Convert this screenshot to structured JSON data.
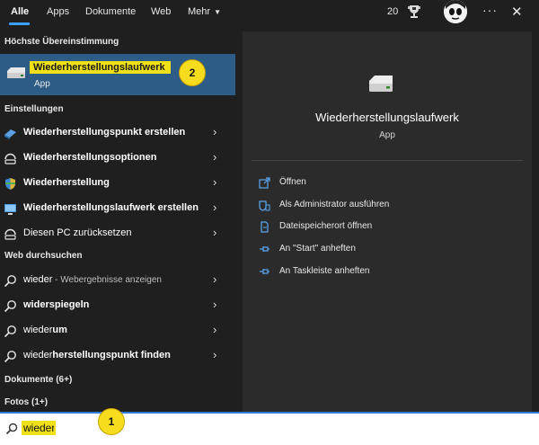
{
  "tabs": [
    {
      "label": "Alle",
      "active": true
    },
    {
      "label": "Apps"
    },
    {
      "label": "Dokumente"
    },
    {
      "label": "Web"
    },
    {
      "label": "Mehr"
    }
  ],
  "topbar": {
    "points": "20",
    "more": "···",
    "close": "✕"
  },
  "sections": {
    "best": "Höchste Übereinstimmung",
    "settings": "Einstellungen",
    "web": "Web durchsuchen",
    "docs": "Dokumente (6+)",
    "photos": "Fotos (1+)"
  },
  "best_match": {
    "title": "Wiederherstellungslaufwerk",
    "subtitle": "App",
    "badge": "2"
  },
  "settings_items": [
    {
      "bold": "Wieder",
      "rest": "herstellungspunkt erstellen",
      "icon": "system-restore-icon"
    },
    {
      "bold": "Wieder",
      "rest": "herstellungsoptionen",
      "icon": "recovery-options-icon"
    },
    {
      "bold": "Wieder",
      "rest": "herstellung",
      "icon": "shield-icon"
    },
    {
      "bold": "Wieder",
      "rest": "herstellungslaufwerk erstellen",
      "icon": "monitor-icon"
    },
    {
      "text": "Diesen PC zurücksetzen",
      "icon": "reset-pc-icon"
    }
  ],
  "web_items": [
    {
      "prefix": "wieder",
      "bold": "",
      "hint": " - Webergebnisse anzeigen"
    },
    {
      "prefix": "",
      "bold": "widerspiegeln",
      "hint": ""
    },
    {
      "prefix": "wieder",
      "bold": "um",
      "hint": ""
    },
    {
      "prefix": "wieder",
      "bold": "herstellungspunkt finden",
      "hint": ""
    }
  ],
  "detail": {
    "title": "Wiederherstellungslaufwerk",
    "subtitle": "App"
  },
  "actions": [
    {
      "label": "Öffnen",
      "icon": "open-icon"
    },
    {
      "label": "Als Administrator ausführen",
      "icon": "admin-shield-icon"
    },
    {
      "label": "Dateispeicherort öffnen",
      "icon": "file-location-icon"
    },
    {
      "label": "An \"Start\" anheften",
      "icon": "pin-icon"
    },
    {
      "label": "An Taskleiste anheften",
      "icon": "pin-taskbar-icon"
    }
  ],
  "search": {
    "value": "wieder",
    "badge": "1"
  },
  "colors": {
    "accent": "#2d5c86",
    "highlight": "#f0e018",
    "badge": "#f6dc1c"
  }
}
